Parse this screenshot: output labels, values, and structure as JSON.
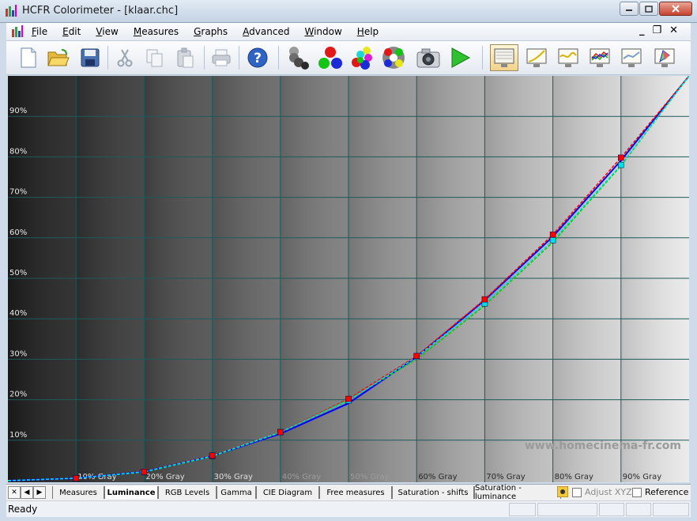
{
  "window": {
    "title": "HCFR Colorimeter - [klaar.chc]"
  },
  "menu": [
    "File",
    "Edit",
    "View",
    "Measures",
    "Graphs",
    "Advanced",
    "Window",
    "Help"
  ],
  "toolbar": {
    "buttons": [
      "new-icon",
      "open-icon",
      "save-icon",
      "cut-icon",
      "copy-icon",
      "paste-icon",
      "print-icon",
      "help-icon",
      "gray-measure-icon",
      "primary-colors-icon",
      "secondary-colors-icon",
      "all-colors-icon",
      "camera-icon",
      "play-icon",
      "gray-view-icon",
      "gamma-view-icon",
      "luminance-view-icon",
      "rgb-levels-view-icon",
      "saturation-view-icon",
      "cie-view-icon"
    ]
  },
  "graph": {
    "watermark": "www.homecinema-fr.com",
    "y_labels": [
      "90%",
      "80%",
      "70%",
      "60%",
      "50%",
      "40%",
      "30%",
      "20%",
      "10%"
    ],
    "x_labels": [
      "10% Gray",
      "20% Gray",
      "30% Gray",
      "40% Gray",
      "50% Gray",
      "60% Gray",
      "70% Gray",
      "80% Gray",
      "90% Gray"
    ]
  },
  "chart_data": {
    "type": "line",
    "x": [
      0,
      10,
      20,
      30,
      40,
      50,
      60,
      70,
      80,
      90,
      100
    ],
    "ylim": [
      0,
      100
    ],
    "series": [
      {
        "color": "#0000ff",
        "values": [
          0,
          0.6,
          2.2,
          6.1,
          11.6,
          19.1,
          30.6,
          44.6,
          60.3,
          79.1,
          100
        ]
      },
      {
        "color": "#ff0000",
        "values": [
          0,
          0.6,
          2.2,
          6.2,
          12.0,
          20.2,
          30.8,
          44.8,
          60.8,
          79.8,
          100
        ]
      },
      {
        "color": "#00cc00",
        "values": [
          0,
          0.6,
          2.1,
          6.0,
          11.9,
          20.0,
          30.0,
          43.3,
          58.9,
          77.8,
          100
        ]
      },
      {
        "color": "#00e0e0",
        "values": [
          0,
          0.6,
          2.2,
          6.1,
          12.0,
          19.8,
          30.6,
          43.8,
          59.4,
          78.0,
          100
        ]
      }
    ],
    "markers": [
      {
        "color": "#00e0e0",
        "values": [
          0,
          0.6,
          2.2,
          6.1,
          12.0,
          19.8,
          30.6,
          43.8,
          59.4,
          78.0,
          100
        ]
      },
      {
        "color": "#ff0000",
        "values": [
          0,
          0.6,
          2.2,
          6.2,
          12.0,
          20.2,
          30.8,
          44.8,
          60.8,
          79.8,
          100
        ]
      }
    ]
  },
  "tabs": {
    "items": [
      "Measures",
      "Luminance",
      "RGB Levels",
      "Gamma",
      "CIE Diagram",
      "Free measures",
      "Saturation - shifts",
      "Saturation - luminance"
    ],
    "active": "Luminance"
  },
  "options": {
    "adjust_label": "Adjust XYZ",
    "reference_label": "Reference"
  },
  "status": {
    "text": "Ready"
  },
  "colors": {
    "grid": "#1c5a5a",
    "accent_title": "#c4d3e3"
  }
}
